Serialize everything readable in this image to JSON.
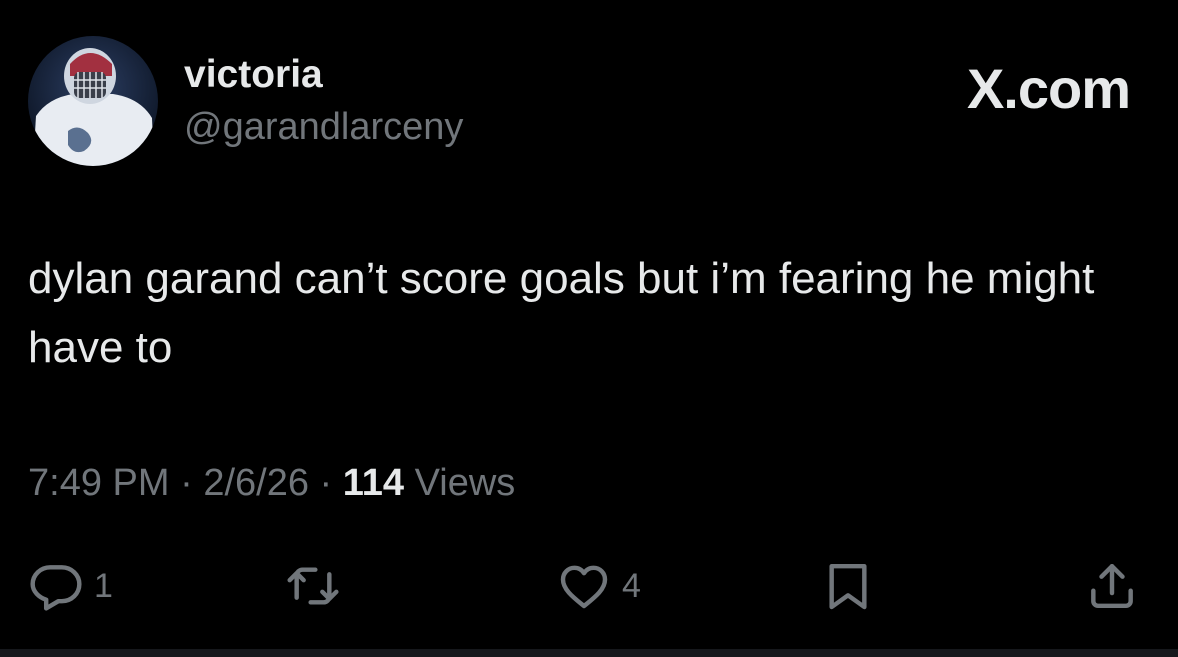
{
  "user": {
    "display_name": "victoria",
    "handle": "@garandlarceny",
    "avatar_icon": "goalie-avatar"
  },
  "brand": {
    "label": "X.com"
  },
  "tweet": {
    "text": "dylan garand can’t score goals but i’m fearing he might have to"
  },
  "meta": {
    "time": "7:49 PM",
    "separator": " · ",
    "date": "2/6/26",
    "views_count": "114",
    "views_label": " Views"
  },
  "actions": {
    "reply": {
      "icon": "reply-icon",
      "count": "1"
    },
    "repost": {
      "icon": "repost-icon",
      "count": ""
    },
    "like": {
      "icon": "heart-icon",
      "count": "4"
    },
    "bookmark": {
      "icon": "bookmark-icon",
      "count": ""
    },
    "share": {
      "icon": "share-icon",
      "count": ""
    }
  },
  "colors": {
    "background": "#000000",
    "primary_text": "#e7e9ea",
    "secondary_text": "#71767b"
  }
}
